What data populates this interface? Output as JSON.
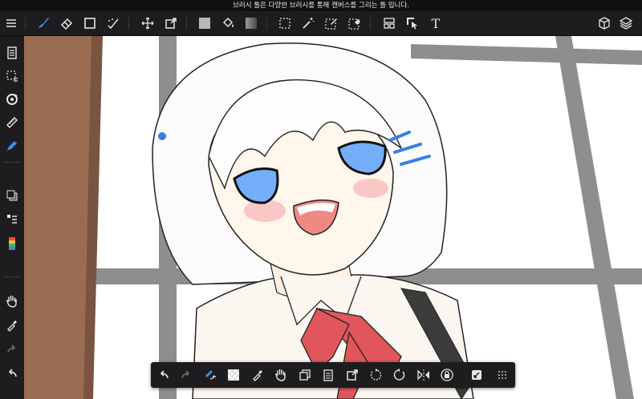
{
  "status_bar": {
    "hint": "브러시 툴은 다양한 브러시를 통해 캔버스를 그리는 툴 입니다."
  },
  "colors": {
    "active_tool": "#3a8ee6",
    "toolbar_bg": "#1d1d1f",
    "icon": "#e6e6e6",
    "canvas": "#ffffff"
  },
  "top_toolbar": {
    "menu": "menu-icon",
    "tools": [
      "brush-tool",
      "eraser-tool",
      "shape-tool",
      "magic-brush-tool",
      "move-tool",
      "transform-tool",
      "fill-color-tool",
      "bucket-tool",
      "gradient-tool",
      "select-tool",
      "magic-wand-tool",
      "select-pen-tool",
      "select-eraser-tool",
      "frame-divider-tool",
      "operation-tool",
      "text-tool",
      "3d-tool",
      "layers-tool"
    ],
    "active_tool": "brush-tool",
    "text_tool_glyph": "T"
  },
  "side_toolbar": {
    "items": [
      "page-icon",
      "selection-icon",
      "rotate-icon",
      "ruler-icon",
      "pen-icon",
      "color-icon",
      "layer-list-icon",
      "color-palette-icon",
      "hand-icon",
      "eyedropper-icon",
      "redo-icon",
      "undo-icon"
    ]
  },
  "bottom_toolbar": {
    "items": [
      "undo-icon",
      "redo-icon",
      "brush-swap-icon",
      "transparent-icon",
      "eyedropper-icon",
      "hand-icon",
      "copy-icon",
      "paste-icon",
      "transform-icon",
      "rotate-left-icon",
      "rotate-right-icon",
      "flip-icon",
      "rotation-lock-icon",
      "fullscreen-icon",
      "more-icon"
    ]
  }
}
